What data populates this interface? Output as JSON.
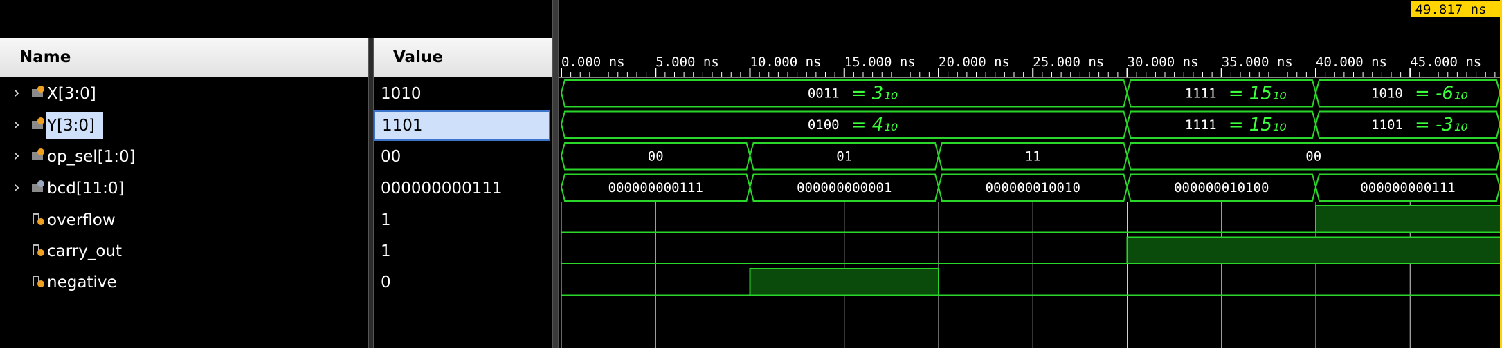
{
  "columns": {
    "name_header": "Name",
    "value_header": "Value"
  },
  "signals": [
    {
      "name": "X[3:0]",
      "value": "1010",
      "kind": "bus",
      "expandable": true,
      "icon": "bus-signal-icon"
    },
    {
      "name": "Y[3:0]",
      "value": "1101",
      "kind": "bus",
      "expandable": true,
      "icon": "bus-signal-icon",
      "selected": true
    },
    {
      "name": "op_sel[1:0]",
      "value": "00",
      "kind": "bus",
      "expandable": true,
      "icon": "bus-signal-icon"
    },
    {
      "name": "bcd[11:0]",
      "value": "000000000111",
      "kind": "bus",
      "expandable": true,
      "icon": "bus-signal-icon"
    },
    {
      "name": "overflow",
      "value": "1",
      "kind": "bit",
      "expandable": false,
      "icon": "bit-signal-icon"
    },
    {
      "name": "carry_out",
      "value": "1",
      "kind": "bit",
      "expandable": false,
      "icon": "bit-signal-icon"
    },
    {
      "name": "negative",
      "value": "0",
      "kind": "bit",
      "expandable": false,
      "icon": "bit-signal-icon"
    }
  ],
  "timeline": {
    "unit": "ns",
    "end_ns": 49.817,
    "cursor_label": "49.817 ns",
    "tick_labels": [
      "0.000 ns",
      "5.000 ns",
      "10.000 ns",
      "15.000 ns",
      "20.000 ns",
      "25.000 ns",
      "30.000 ns",
      "35.000 ns",
      "40.000 ns",
      "45.000 ns"
    ]
  },
  "waves": {
    "X[3:0]": [
      {
        "start": 0,
        "end": 30,
        "label": "0011",
        "note": "= 3₁₀"
      },
      {
        "start": 30,
        "end": 40,
        "label": "1111",
        "note": "= 15₁₀"
      },
      {
        "start": 40,
        "end": 49.817,
        "label": "1010",
        "note": "= -6₁₀"
      }
    ],
    "Y[3:0]": [
      {
        "start": 0,
        "end": 30,
        "label": "0100",
        "note": "= 4₁₀"
      },
      {
        "start": 30,
        "end": 40,
        "label": "1111",
        "note": "= 15₁₀"
      },
      {
        "start": 40,
        "end": 49.817,
        "label": "1101",
        "note": "= -3₁₀"
      }
    ],
    "op_sel[1:0]": [
      {
        "start": 0,
        "end": 10,
        "label": "00"
      },
      {
        "start": 10,
        "end": 20,
        "label": "01"
      },
      {
        "start": 20,
        "end": 30,
        "label": "11"
      },
      {
        "start": 30,
        "end": 49.817,
        "label": "00"
      }
    ],
    "bcd[11:0]": [
      {
        "start": 0,
        "end": 10,
        "label": "000000000111"
      },
      {
        "start": 10,
        "end": 20,
        "label": "000000000001"
      },
      {
        "start": 20,
        "end": 30,
        "label": "000000010010"
      },
      {
        "start": 30,
        "end": 40,
        "label": "000000010100"
      },
      {
        "start": 40,
        "end": 49.817,
        "label": "000000000111"
      }
    ],
    "overflow": [
      {
        "start": 0,
        "end": 40,
        "level": 0
      },
      {
        "start": 40,
        "end": 49.817,
        "level": 1
      }
    ],
    "carry_out": [
      {
        "start": 0,
        "end": 30,
        "level": 0
      },
      {
        "start": 30,
        "end": 49.817,
        "level": 1
      }
    ],
    "negative": [
      {
        "start": 0,
        "end": 10,
        "level": 0
      },
      {
        "start": 10,
        "end": 20,
        "level": 1
      },
      {
        "start": 20,
        "end": 49.817,
        "level": 0
      }
    ]
  },
  "colors": {
    "wave": "#2bd62b",
    "high_fill": "#0a4a0a",
    "grid": "#cfcfcf",
    "cursor": "#ffd400",
    "selection": "#cfe0fb"
  }
}
